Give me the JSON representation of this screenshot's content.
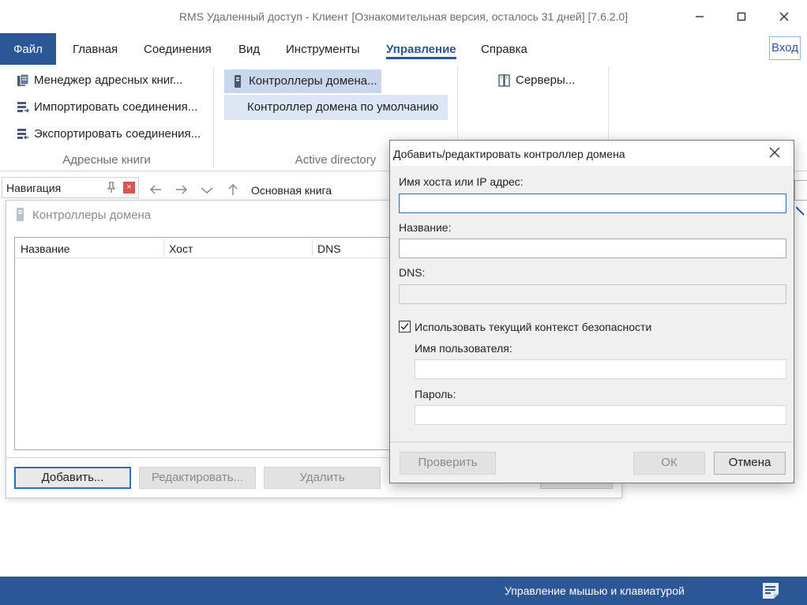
{
  "window": {
    "title": "RMS Удаленный доступ - Клиент [Ознакомительная версия, осталось 31 дней] [7.6.2.0]"
  },
  "tabs": [
    {
      "label": "Файл"
    },
    {
      "label": "Главная"
    },
    {
      "label": "Соединения"
    },
    {
      "label": "Вид"
    },
    {
      "label": "Инструменты"
    },
    {
      "label": "Управление"
    },
    {
      "label": "Справка"
    }
  ],
  "login_label": "Вход",
  "ribbon": {
    "address_books": {
      "items": [
        "Менеджер адресных книг...",
        "Импортировать соединения...",
        "Экспортировать соединения..."
      ],
      "label": "Адресные книги"
    },
    "active_directory": {
      "items": [
        "Контроллеры домена...",
        "Контроллер домена по умолчанию"
      ],
      "label": "Active directory"
    },
    "servers": {
      "items": [
        "Серверы..."
      ]
    }
  },
  "navigation": {
    "label": "Навигация",
    "breadcrumb": "Основная книга"
  },
  "domain_window": {
    "title": "Контроллеры домена",
    "columns": [
      "Название",
      "Хост",
      "DNS"
    ],
    "buttons": {
      "add": "Добавить...",
      "edit": "Редактировать...",
      "delete": "Удалить"
    }
  },
  "dialog": {
    "title": "Добавить/редактировать контроллер домена",
    "host_label": "Имя хоста или IP адрес:",
    "host_value": "",
    "name_label": "Название:",
    "name_value": "",
    "dns_label": "DNS:",
    "dns_value": "",
    "use_context_label": "Использовать текущий контекст безопасности",
    "use_context_checked": true,
    "username_label": "Имя пользователя:",
    "username_value": "",
    "password_label": "Пароль:",
    "password_value": "",
    "check_button": "Проверить",
    "ok_button": "ОК",
    "cancel_button": "Отмена"
  },
  "statusbar": {
    "text": "Управление мышью и клавиатурой"
  },
  "colors": {
    "accent": "#2b5797",
    "focus": "#2b6cc4"
  }
}
